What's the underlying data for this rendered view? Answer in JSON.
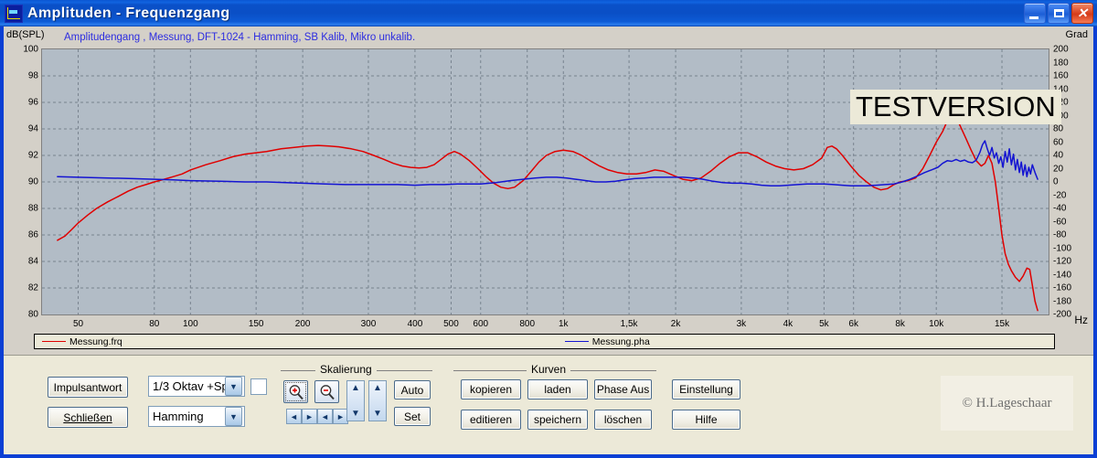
{
  "window": {
    "title": "Amplituden - Frequenzgang",
    "icon": "chart-window-icon",
    "minimize_label": "_",
    "maximize_label": "",
    "close_label": "✕"
  },
  "chart_header": {
    "y_axis_label": "dB(SPL)",
    "subtitle": "Amplitudengang , Messung, DFT-1024 - Hamming, SB Kalib, Mikro unkalib.",
    "right_axis_label": "Grad",
    "x_axis_label": "Hz",
    "watermark": "TESTVERSION"
  },
  "legend": {
    "entries": [
      {
        "label": "Messung.frq",
        "color": "#e00000"
      },
      {
        "label": "Messung.pha",
        "color": "#1414d2"
      }
    ]
  },
  "controls": {
    "impulsantwort_label": "Impulsantwort",
    "schliessen_label": "Schließen",
    "smoothing_value": "1/3 Oktav +Sp",
    "window_value": "Hamming",
    "combo_arrow": "▼",
    "checkbox_checked": false,
    "skalierung": {
      "title": "Skalierung",
      "zoom_in_icon": "magnifier-plus-icon",
      "zoom_out_icon": "magnifier-minus-icon",
      "left_arrow": "◄",
      "right_arrow": "►",
      "up_arrow": "▲",
      "down_arrow": "▼",
      "auto_label": "Auto",
      "set_label": "Set"
    },
    "kurven": {
      "title": "Kurven",
      "kopieren_label": "kopieren",
      "laden_label": "laden",
      "phase_aus_label": "Phase Aus",
      "editieren_label": "editieren",
      "speichern_label": "speichern",
      "loeschen_label": "löschen"
    },
    "einstellung_label": "Einstellung",
    "hilfe_label": "Hilfe",
    "copyright": "© H.Lageschaar"
  },
  "chart_data": {
    "type": "line",
    "title": "Amplitudengang , Messung, DFT-1024 - Hamming, SB Kalib, Mikro unkalib.",
    "xlabel": "Hz",
    "ylabel": "dB(SPL)",
    "y2label": "Grad",
    "xscale": "log",
    "xlim": [
      40,
      20000
    ],
    "ylim": [
      80,
      100
    ],
    "y2lim": [
      -200,
      200
    ],
    "grid": true,
    "legend_position": "bottom",
    "x_ticks": [
      {
        "value": 50,
        "label": "50"
      },
      {
        "value": 80,
        "label": "80"
      },
      {
        "value": 100,
        "label": "100"
      },
      {
        "value": 150,
        "label": "150"
      },
      {
        "value": 200,
        "label": "200"
      },
      {
        "value": 300,
        "label": "300"
      },
      {
        "value": 400,
        "label": "400"
      },
      {
        "value": 500,
        "label": "500"
      },
      {
        "value": 600,
        "label": "600"
      },
      {
        "value": 800,
        "label": "800"
      },
      {
        "value": 1000,
        "label": "1k"
      },
      {
        "value": 1500,
        "label": "1,5k"
      },
      {
        "value": 2000,
        "label": "2k"
      },
      {
        "value": 3000,
        "label": "3k"
      },
      {
        "value": 4000,
        "label": "4k"
      },
      {
        "value": 5000,
        "label": "5k"
      },
      {
        "value": 6000,
        "label": "6k"
      },
      {
        "value": 8000,
        "label": "8k"
      },
      {
        "value": 10000,
        "label": "10k"
      },
      {
        "value": 15000,
        "label": "15k"
      }
    ],
    "y_ticks": [
      {
        "value": 100,
        "label": "100"
      },
      {
        "value": 98,
        "label": "98"
      },
      {
        "value": 96,
        "label": "96"
      },
      {
        "value": 94,
        "label": "94"
      },
      {
        "value": 92,
        "label": "92"
      },
      {
        "value": 90,
        "label": "90"
      },
      {
        "value": 88,
        "label": "88"
      },
      {
        "value": 86,
        "label": "86"
      },
      {
        "value": 84,
        "label": "84"
      },
      {
        "value": 82,
        "label": "82"
      },
      {
        "value": 80,
        "label": "80"
      }
    ],
    "y2_ticks": [
      {
        "value": 200,
        "label": "200"
      },
      {
        "value": 180,
        "label": "180"
      },
      {
        "value": 160,
        "label": "160"
      },
      {
        "value": 140,
        "label": "140"
      },
      {
        "value": 120,
        "label": "120"
      },
      {
        "value": 100,
        "label": "100"
      },
      {
        "value": 80,
        "label": "80"
      },
      {
        "value": 60,
        "label": "60"
      },
      {
        "value": 40,
        "label": "40"
      },
      {
        "value": 20,
        "label": "20"
      },
      {
        "value": 0,
        "label": "0"
      },
      {
        "value": -20,
        "label": "-20"
      },
      {
        "value": -40,
        "label": "-40"
      },
      {
        "value": -60,
        "label": "-60"
      },
      {
        "value": -80,
        "label": "-80"
      },
      {
        "value": -100,
        "label": "-100"
      },
      {
        "value": -120,
        "label": "-120"
      },
      {
        "value": -140,
        "label": "-140"
      },
      {
        "value": -160,
        "label": "-160"
      },
      {
        "value": -180,
        "label": "-180"
      },
      {
        "value": -200,
        "label": "-200"
      }
    ],
    "series": [
      {
        "name": "Messung.frq",
        "color": "#e00000",
        "axis": "left",
        "unit": "dB(SPL)",
        "points": [
          [
            44,
            85.6
          ],
          [
            46,
            85.9
          ],
          [
            48,
            86.4
          ],
          [
            50,
            86.9
          ],
          [
            53,
            87.5
          ],
          [
            56,
            88.0
          ],
          [
            60,
            88.5
          ],
          [
            64,
            88.9
          ],
          [
            68,
            89.3
          ],
          [
            72,
            89.6
          ],
          [
            76,
            89.8
          ],
          [
            80,
            90.0
          ],
          [
            85,
            90.2
          ],
          [
            90,
            90.4
          ],
          [
            95,
            90.6
          ],
          [
            100,
            90.9
          ],
          [
            110,
            91.3
          ],
          [
            120,
            91.6
          ],
          [
            130,
            91.9
          ],
          [
            140,
            92.1
          ],
          [
            150,
            92.2
          ],
          [
            160,
            92.3
          ],
          [
            175,
            92.5
          ],
          [
            190,
            92.6
          ],
          [
            205,
            92.7
          ],
          [
            220,
            92.75
          ],
          [
            235,
            92.7
          ],
          [
            250,
            92.65
          ],
          [
            270,
            92.5
          ],
          [
            290,
            92.3
          ],
          [
            310,
            92.0
          ],
          [
            330,
            91.7
          ],
          [
            350,
            91.4
          ],
          [
            370,
            91.2
          ],
          [
            390,
            91.1
          ],
          [
            410,
            91.05
          ],
          [
            430,
            91.1
          ],
          [
            450,
            91.3
          ],
          [
            470,
            91.7
          ],
          [
            490,
            92.1
          ],
          [
            510,
            92.3
          ],
          [
            530,
            92.1
          ],
          [
            560,
            91.6
          ],
          [
            590,
            91.0
          ],
          [
            620,
            90.4
          ],
          [
            650,
            89.9
          ],
          [
            680,
            89.6
          ],
          [
            710,
            89.5
          ],
          [
            740,
            89.6
          ],
          [
            780,
            90.1
          ],
          [
            820,
            90.8
          ],
          [
            860,
            91.5
          ],
          [
            900,
            92.0
          ],
          [
            950,
            92.3
          ],
          [
            1000,
            92.4
          ],
          [
            1060,
            92.3
          ],
          [
            1120,
            92.0
          ],
          [
            1180,
            91.6
          ],
          [
            1250,
            91.2
          ],
          [
            1320,
            90.9
          ],
          [
            1400,
            90.7
          ],
          [
            1480,
            90.6
          ],
          [
            1570,
            90.6
          ],
          [
            1660,
            90.7
          ],
          [
            1760,
            90.9
          ],
          [
            1860,
            90.8
          ],
          [
            1970,
            90.5
          ],
          [
            2090,
            90.2
          ],
          [
            2210,
            90.1
          ],
          [
            2340,
            90.3
          ],
          [
            2480,
            90.8
          ],
          [
            2630,
            91.4
          ],
          [
            2790,
            91.9
          ],
          [
            2950,
            92.2
          ],
          [
            3120,
            92.2
          ],
          [
            3300,
            91.9
          ],
          [
            3500,
            91.5
          ],
          [
            3700,
            91.2
          ],
          [
            3920,
            91.0
          ],
          [
            4150,
            90.9
          ],
          [
            4400,
            91.0
          ],
          [
            4660,
            91.3
          ],
          [
            4930,
            91.8
          ],
          [
            5100,
            92.6
          ],
          [
            5250,
            92.7
          ],
          [
            5400,
            92.5
          ],
          [
            5600,
            92.0
          ],
          [
            5900,
            91.2
          ],
          [
            6200,
            90.5
          ],
          [
            6500,
            90.0
          ],
          [
            6800,
            89.6
          ],
          [
            7100,
            89.4
          ],
          [
            7400,
            89.5
          ],
          [
            7700,
            89.8
          ],
          [
            8000,
            90.0
          ],
          [
            8400,
            90.1
          ],
          [
            8800,
            90.3
          ],
          [
            9200,
            91.0
          ],
          [
            9600,
            92.0
          ],
          [
            10000,
            93.0
          ],
          [
            10400,
            93.8
          ],
          [
            10700,
            94.6
          ],
          [
            11000,
            95.2
          ],
          [
            11300,
            94.9
          ],
          [
            11600,
            94.2
          ],
          [
            12000,
            93.3
          ],
          [
            12400,
            92.4
          ],
          [
            12800,
            91.6
          ],
          [
            13200,
            91.2
          ],
          [
            13500,
            91.4
          ],
          [
            13800,
            92.0
          ],
          [
            14100,
            91.4
          ],
          [
            14400,
            90.0
          ],
          [
            14700,
            88.0
          ],
          [
            15000,
            86.0
          ],
          [
            15300,
            84.6
          ],
          [
            15600,
            83.8
          ],
          [
            15900,
            83.3
          ],
          [
            16300,
            82.8
          ],
          [
            16700,
            82.5
          ],
          [
            17100,
            82.9
          ],
          [
            17500,
            83.5
          ],
          [
            17800,
            83.4
          ],
          [
            18100,
            82.2
          ],
          [
            18400,
            81.0
          ],
          [
            18700,
            80.3
          ]
        ]
      },
      {
        "name": "Messung.pha",
        "color": "#1414d2",
        "axis": "right",
        "unit": "Grad",
        "points": [
          [
            44,
            8
          ],
          [
            50,
            7
          ],
          [
            60,
            6
          ],
          [
            70,
            5
          ],
          [
            80,
            4
          ],
          [
            90,
            3
          ],
          [
            100,
            2
          ],
          [
            120,
            1
          ],
          [
            140,
            0
          ],
          [
            160,
            0
          ],
          [
            180,
            -1
          ],
          [
            200,
            -2
          ],
          [
            230,
            -3
          ],
          [
            260,
            -4
          ],
          [
            290,
            -4
          ],
          [
            320,
            -4
          ],
          [
            360,
            -4
          ],
          [
            400,
            -5
          ],
          [
            440,
            -4
          ],
          [
            480,
            -4
          ],
          [
            520,
            -3
          ],
          [
            560,
            -3
          ],
          [
            600,
            -3
          ],
          [
            660,
            -1
          ],
          [
            720,
            2
          ],
          [
            780,
            4
          ],
          [
            840,
            6
          ],
          [
            900,
            7
          ],
          [
            960,
            7
          ],
          [
            1020,
            6
          ],
          [
            1080,
            4
          ],
          [
            1150,
            2
          ],
          [
            1220,
            0
          ],
          [
            1300,
            0
          ],
          [
            1380,
            1
          ],
          [
            1460,
            3
          ],
          [
            1550,
            5
          ],
          [
            1650,
            6
          ],
          [
            1750,
            7
          ],
          [
            1860,
            7
          ],
          [
            1980,
            7
          ],
          [
            2100,
            7
          ],
          [
            2230,
            6
          ],
          [
            2370,
            4
          ],
          [
            2520,
            1
          ],
          [
            2680,
            -1
          ],
          [
            2850,
            -2
          ],
          [
            3000,
            -2
          ],
          [
            3200,
            -3
          ],
          [
            3400,
            -5
          ],
          [
            3600,
            -6
          ],
          [
            3800,
            -6
          ],
          [
            4000,
            -5
          ],
          [
            4250,
            -4
          ],
          [
            4500,
            -3
          ],
          [
            4750,
            -3
          ],
          [
            5000,
            -3
          ],
          [
            5300,
            -4
          ],
          [
            5600,
            -5
          ],
          [
            5900,
            -6
          ],
          [
            6200,
            -6
          ],
          [
            6500,
            -6
          ],
          [
            6900,
            -5
          ],
          [
            7300,
            -4
          ],
          [
            7700,
            -3
          ],
          [
            8100,
            0
          ],
          [
            8500,
            4
          ],
          [
            8900,
            9
          ],
          [
            9300,
            14
          ],
          [
            9700,
            18
          ],
          [
            10100,
            22
          ],
          [
            10400,
            28
          ],
          [
            10700,
            32
          ],
          [
            11000,
            31
          ],
          [
            11300,
            34
          ],
          [
            11600,
            31
          ],
          [
            11900,
            33
          ],
          [
            12200,
            30
          ],
          [
            12500,
            29
          ],
          [
            12800,
            33
          ],
          [
            13100,
            45
          ],
          [
            13300,
            56
          ],
          [
            13500,
            62
          ],
          [
            13700,
            50
          ],
          [
            13900,
            40
          ],
          [
            14100,
            52
          ],
          [
            14300,
            36
          ],
          [
            14500,
            44
          ],
          [
            14700,
            28
          ],
          [
            14900,
            38
          ],
          [
            15100,
            22
          ],
          [
            15300,
            46
          ],
          [
            15500,
            30
          ],
          [
            15700,
            50
          ],
          [
            15900,
            26
          ],
          [
            16100,
            42
          ],
          [
            16300,
            18
          ],
          [
            16500,
            34
          ],
          [
            16700,
            14
          ],
          [
            16900,
            30
          ],
          [
            17100,
            10
          ],
          [
            17300,
            26
          ],
          [
            17500,
            8
          ],
          [
            17700,
            22
          ],
          [
            17900,
            12
          ],
          [
            18100,
            26
          ],
          [
            18400,
            14
          ],
          [
            18700,
            4
          ]
        ]
      }
    ]
  }
}
